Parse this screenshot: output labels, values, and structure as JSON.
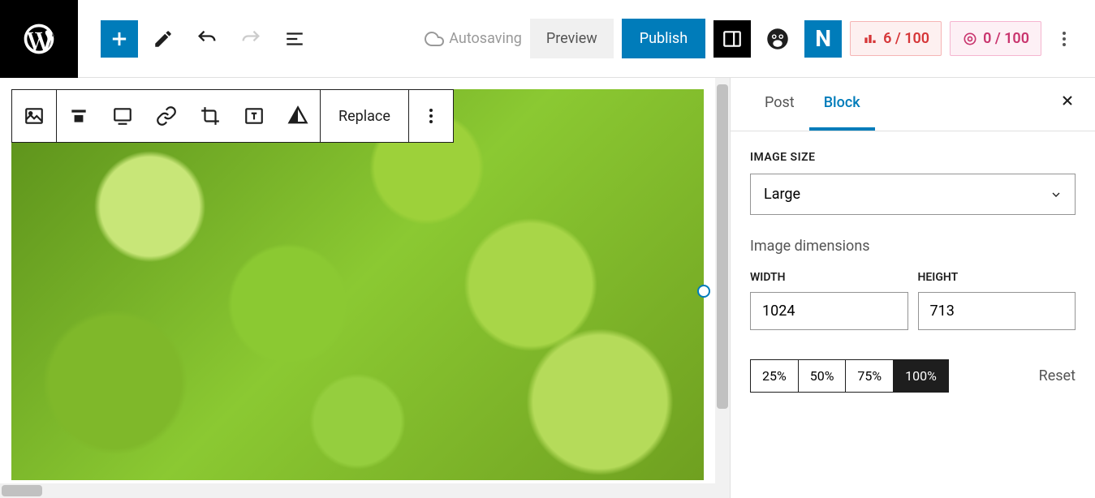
{
  "toolbar": {
    "autosave": "Autosaving",
    "preview": "Preview",
    "publish": "Publish",
    "plugin_n": "N",
    "score1": "6 / 100",
    "score2": "0 / 100"
  },
  "block_toolbar": {
    "replace": "Replace"
  },
  "sidebar": {
    "tabs": {
      "post": "Post",
      "block": "Block"
    },
    "image_size_label": "IMAGE SIZE",
    "image_size_value": "Large",
    "dimensions_label": "Image dimensions",
    "width_label": "WIDTH",
    "width_value": "1024",
    "height_label": "HEIGHT",
    "height_value": "713",
    "pct": [
      "25%",
      "50%",
      "75%",
      "100%"
    ],
    "reset": "Reset"
  }
}
